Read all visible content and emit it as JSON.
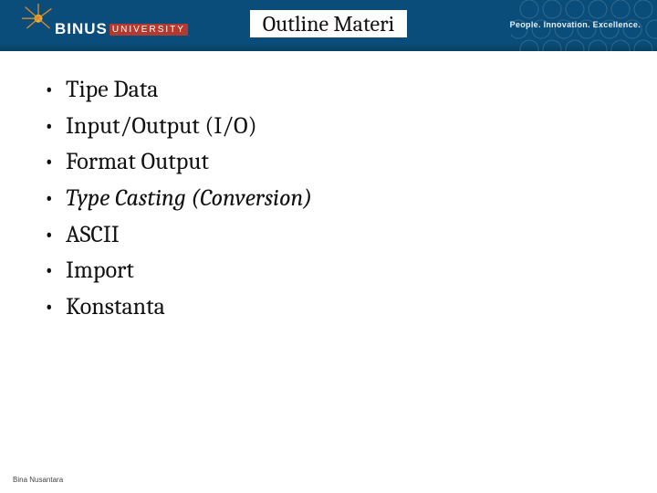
{
  "header": {
    "title": "Outline Materi",
    "logo_main": "BINUS",
    "logo_sub": "UNIVERSITY",
    "tagline": "People. Innovation. Excellence."
  },
  "bullets": [
    {
      "text": "Tipe Data",
      "italic": false
    },
    {
      "text": "Input/Output (I/O)",
      "italic": false
    },
    {
      "text": "Format Output",
      "italic": false
    },
    {
      "text": "Type Casting (Conversion)",
      "italic": true
    },
    {
      "text": "ASCII",
      "italic": false
    },
    {
      "text": "Import",
      "italic": false
    },
    {
      "text": "Konstanta",
      "italic": false
    }
  ],
  "footer": {
    "text": "Bina Nusantara"
  }
}
